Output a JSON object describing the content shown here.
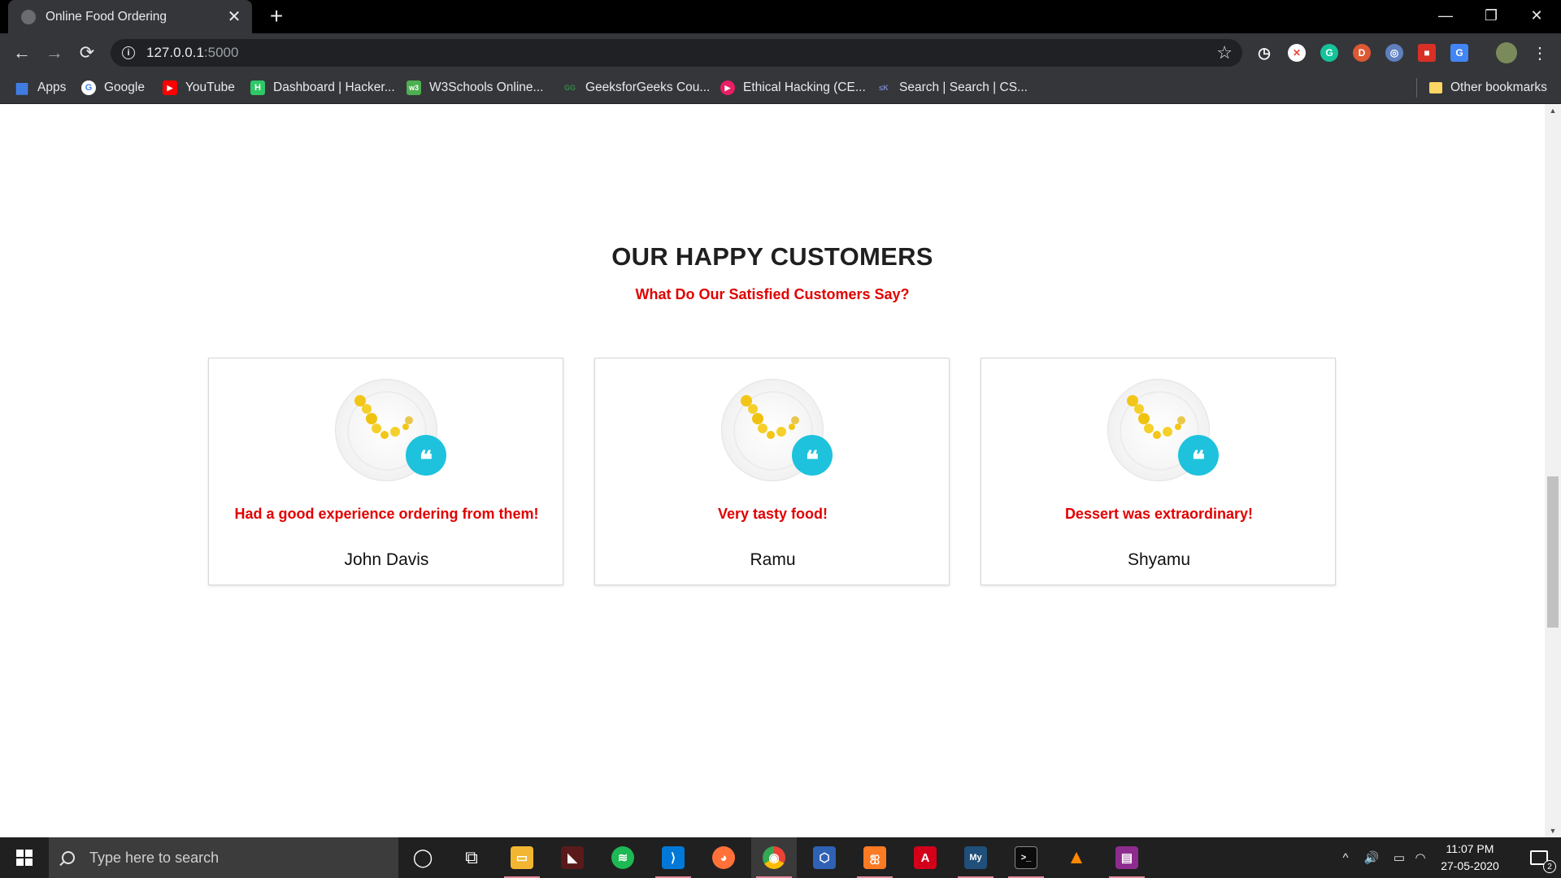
{
  "browser": {
    "tab_title": "Online Food Ordering",
    "tab_close_glyph": "✕",
    "new_tab_glyph": "+",
    "window_controls": {
      "minimize": "—",
      "restore": "❐",
      "close": "✕"
    },
    "nav": {
      "back": "←",
      "forward": "→",
      "reload": "⟳"
    },
    "address": {
      "host": "127.0.0.1",
      "port": ":5000"
    },
    "bookmark_star": "☆",
    "menu_glyph": "⋮",
    "extensions": [
      {
        "name": "speed-dial-icon",
        "glyph": "◷",
        "color": "#ffffff"
      },
      {
        "name": "adblock-icon",
        "glyph": "✕",
        "color": "#e8453c"
      },
      {
        "name": "grammarly-icon",
        "glyph": "G",
        "color": "#15c39a"
      },
      {
        "name": "duckduckgo-icon",
        "glyph": "D",
        "color": "#de5833"
      },
      {
        "name": "eye-extension-icon",
        "glyph": "◎",
        "color": "#5f7fbf"
      },
      {
        "name": "bookmark-extension-icon",
        "glyph": "■",
        "color": "#d93025"
      },
      {
        "name": "translate-icon",
        "glyph": "G",
        "color": "#4285f4"
      }
    ]
  },
  "bookmarks": [
    {
      "label": "Apps",
      "icon": "apps-grid-icon",
      "color": "#4285f4",
      "glyph": "▦"
    },
    {
      "label": "Google",
      "icon": "google-icon",
      "color": "#ffffff",
      "glyph": "G"
    },
    {
      "label": "YouTube",
      "icon": "youtube-icon",
      "color": "#ff0000",
      "glyph": "▶"
    },
    {
      "label": "Dashboard | Hacker...",
      "icon": "hackerrank-icon",
      "color": "#2ec866",
      "glyph": "H"
    },
    {
      "label": "W3Schools Online...",
      "icon": "w3schools-icon",
      "color": "#4caf50",
      "glyph": "w3"
    },
    {
      "label": "GeeksforGeeks Cou...",
      "icon": "geeksforgeeks-icon",
      "color": "#2f8d46",
      "glyph": "GG"
    },
    {
      "label": "Ethical Hacking (CE...",
      "icon": "ethical-hacking-icon",
      "color": "#e91e63",
      "glyph": "▶"
    },
    {
      "label": "Search | Search | CS...",
      "icon": "cs-search-icon",
      "color": "#3f51b5",
      "glyph": "≤K"
    }
  ],
  "other_bookmarks": "Other bookmarks",
  "page": {
    "title": "OUR HAPPY CUSTOMERS",
    "subtitle": "What Do Our Satisfied Customers Say?",
    "testimonials": [
      {
        "review": "Had a good experience ordering from them!",
        "name": "John Davis"
      },
      {
        "review": "Very tasty food!",
        "name": "Ramu"
      },
      {
        "review": "Dessert was extraordinary!",
        "name": "Shyamu"
      }
    ],
    "quote_glyph": "❝",
    "accent_red": "#e10000",
    "accent_cyan": "#1fc2dc"
  },
  "scrollbar": {
    "up": "▲",
    "down": "▼"
  },
  "taskbar": {
    "search_placeholder": "Type here to search",
    "apps": [
      {
        "name": "cortana-icon",
        "glyph": "◯",
        "color": "transparent",
        "running": false
      },
      {
        "name": "task-view-icon",
        "glyph": "⧉",
        "color": "transparent",
        "running": false
      },
      {
        "name": "file-explorer-icon",
        "glyph": "▭",
        "color": "#f2b632",
        "running": true
      },
      {
        "name": "predator-sense-icon",
        "glyph": "◣",
        "color": "#5a1a1a",
        "running": false
      },
      {
        "name": "spotify-icon",
        "glyph": "≋",
        "color": "#1db954",
        "running": false
      },
      {
        "name": "vscode-icon",
        "glyph": "⟩",
        "color": "#0078d7",
        "running": true
      },
      {
        "name": "firefox-icon",
        "glyph": "◕",
        "color": "#ff7139",
        "running": false
      },
      {
        "name": "chrome-icon",
        "glyph": "◉",
        "color": "#4caf50",
        "running": true
      },
      {
        "name": "virtualbox-icon",
        "glyph": "⬡",
        "color": "#2f61b4",
        "running": false
      },
      {
        "name": "xampp-icon",
        "glyph": "ஐ",
        "color": "#fb7a24",
        "running": true
      },
      {
        "name": "acrobat-icon",
        "glyph": "A",
        "color": "#d4001a",
        "running": false
      },
      {
        "name": "mysql-icon",
        "glyph": "My",
        "color": "#1f4f7a",
        "running": true
      },
      {
        "name": "terminal-icon",
        "glyph": ">_",
        "color": "#0c0c0c",
        "running": true
      },
      {
        "name": "vlc-icon",
        "glyph": "▲",
        "color": "#ff8800",
        "running": false
      },
      {
        "name": "winrar-icon",
        "glyph": "▤",
        "color": "#8e2b8e",
        "running": true
      }
    ],
    "tray": {
      "chevron": "^",
      "volume": "🔊",
      "battery": "▭",
      "wifi": "◠"
    },
    "time": "11:07 PM",
    "date": "27-05-2020",
    "notification_count": "2"
  }
}
